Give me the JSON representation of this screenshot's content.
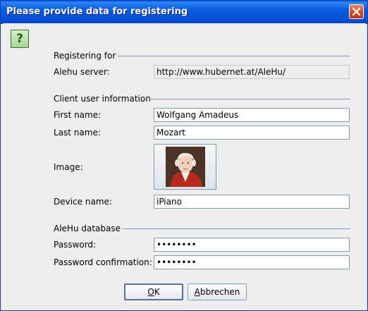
{
  "window": {
    "title": "Please provide data for registering"
  },
  "icons": {
    "question": "question-icon",
    "close": "close-icon"
  },
  "icon_text": "?",
  "sections": {
    "registering": {
      "title": "Registering for"
    },
    "client": {
      "title": "Client user information"
    },
    "database": {
      "title": "AleHu database"
    }
  },
  "fields": {
    "server": {
      "label": "Alehu server:",
      "value": "http://www.hubernet.at/AleHu/"
    },
    "first_name": {
      "label": "First name:",
      "value": "Wolfgang Amadeus"
    },
    "last_name": {
      "label": "Last name:",
      "value": "Mozart"
    },
    "image": {
      "label": "Image:"
    },
    "device_name": {
      "label": "Device name:",
      "value": "iPiano"
    },
    "password": {
      "label": "Password:",
      "value": "••••••••"
    },
    "password_confirmation": {
      "label": "Password confirmation:",
      "value": "••••••••"
    }
  },
  "buttons": {
    "ok": {
      "mnemonic": "O",
      "rest": "K"
    },
    "cancel": {
      "mnemonic": "A",
      "rest": "bbrechen"
    }
  },
  "colors": {
    "titlebar": "#0a5fe6",
    "separator": "#7f9db9",
    "icon_bg": "#a4d68f"
  }
}
